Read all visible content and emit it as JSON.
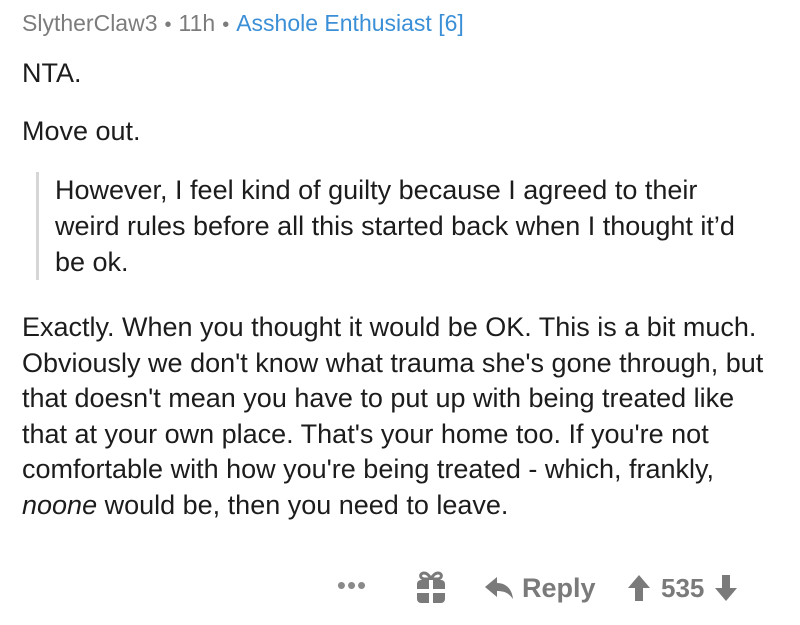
{
  "comment": {
    "author": "SlytherClaw3",
    "separator": "•",
    "age": "11h",
    "flair": "Asshole Enthusiast [6]",
    "paragraphs": {
      "p1": "NTA.",
      "p2": "Move out."
    },
    "quote": "However, I feel kind of guilty because I agreed to their weird rules before all this started back when I thought it’d be ok.",
    "p3_before": "Exactly. When you thought it would be OK. This is a bit much. Obviously we don't know what trauma she's gone through, but that doesn't mean you have to put up with being treated like that at your own place. That's your home too. If you're not comfortable with how you're being treated - which, frankly, ",
    "p3_italic": "noone",
    "p3_after": " would be, then you need to leave."
  },
  "actions": {
    "more_label": "•••",
    "gift_icon": "gift-icon",
    "reply_icon": "reply-arrow-icon",
    "reply_label": "Reply",
    "upvote_icon": "upvote-arrow-icon",
    "score": "535",
    "downvote_icon": "downvote-arrow-icon"
  },
  "colors": {
    "text": "#1c1c1c",
    "meta": "#7c7c7c",
    "flair": "#3a8fd6",
    "quote_bar": "#d6d6d6",
    "action": "#7a7a7a"
  }
}
